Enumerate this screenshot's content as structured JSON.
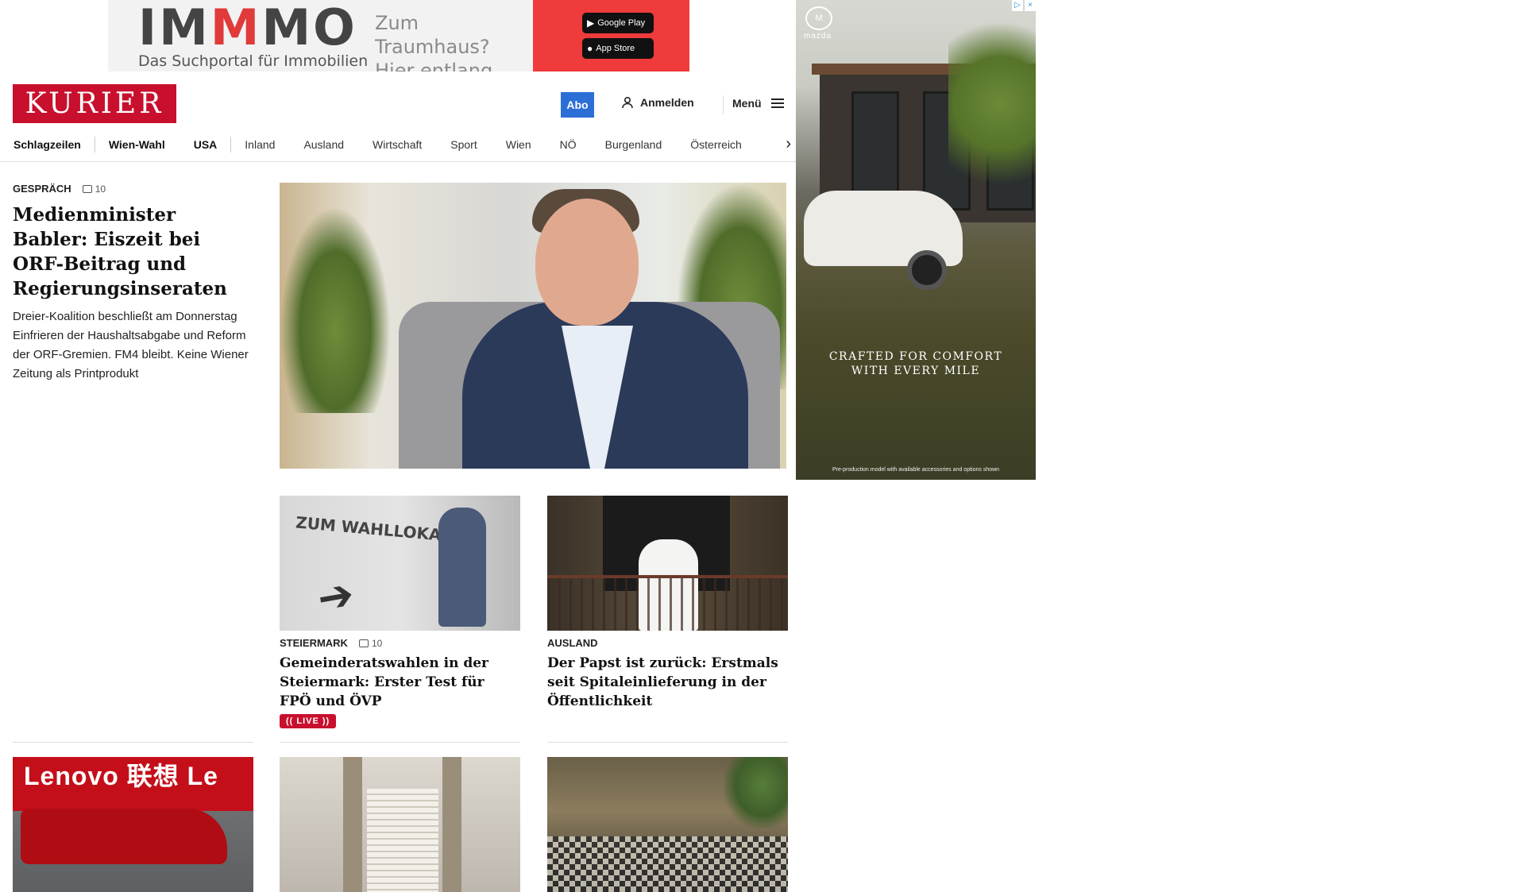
{
  "top_ad": {
    "logo_pre": "IM",
    "logo_red": "M",
    "logo_post": "MO",
    "tagline": "Das Suchportal für Immobilien",
    "claim_line1": "Zum Traumhaus?",
    "claim_line2": "Hier entlang.",
    "google_play": "Google Play",
    "app_store": "App Store"
  },
  "side_ad": {
    "brand": "mazda",
    "slogan_line1": "CRAFTED FOR COMFORT",
    "slogan_line2": "WITH EVERY MILE",
    "disclaimer": "Pre-production model with available accessories and options shown"
  },
  "header": {
    "logo": "KURIER",
    "abo": "Abo",
    "login": "Anmelden",
    "menu": "Menü"
  },
  "nav": {
    "items": [
      "Schlagzeilen",
      "Wien-Wahl",
      "USA",
      "Inland",
      "Ausland",
      "Wirtschaft",
      "Sport",
      "Wien",
      "NÖ",
      "Burgenland",
      "Österreich"
    ]
  },
  "lead": {
    "kicker": "GESPRÄCH",
    "comments": "10",
    "title": "Medienminister Babler: Eiszeit bei ORF-Beitrag und Regierungsinseraten",
    "teaser": "Dreier-Koalition beschließt am Donnerstag Einfrieren der Haushaltsabgabe und Reform der ORF-Gremien. FM4 bleibt. Keine Wiener Zeitung als Printprodukt"
  },
  "cards": [
    {
      "kicker": "STEIERMARK",
      "comments": "10",
      "title": "Gemeinderatswahlen in der Steiermark: Erster Test für FPÖ und ÖVP",
      "live": "(( LIVE ))",
      "image_text": "ZUM WAHLLOKAL"
    },
    {
      "kicker": "AUSLAND",
      "title": "Der Papst ist zurück: Erstmals seit Spitaleinlieferung in der Öffentlichkeit"
    }
  ],
  "bottom_thumbs": {
    "f1_banner": "Lenovo 联想 Le"
  }
}
